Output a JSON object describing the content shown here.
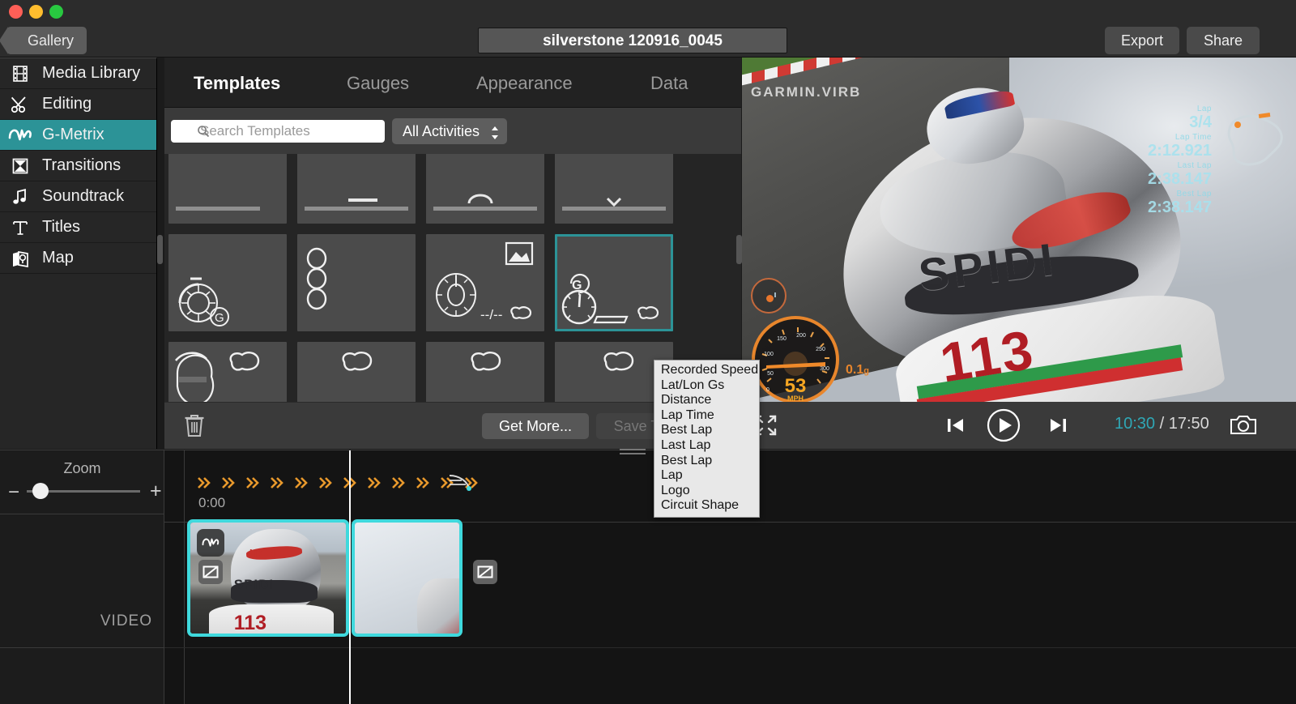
{
  "titlebar": {
    "back_label": "Gallery",
    "document_title": "silverstone 120916_0045",
    "export_label": "Export",
    "share_label": "Share"
  },
  "sidebar": {
    "items": [
      {
        "label": "Media Library",
        "icon": "film-strip-icon",
        "active": false
      },
      {
        "label": "Editing",
        "icon": "scissors-icon",
        "active": false
      },
      {
        "label": "G-Metrix",
        "icon": "pulse-icon",
        "active": true
      },
      {
        "label": "Transitions",
        "icon": "hourglass-icon",
        "active": false
      },
      {
        "label": "Soundtrack",
        "icon": "music-note-icon",
        "active": false
      },
      {
        "label": "Titles",
        "icon": "text-t-icon",
        "active": false
      },
      {
        "label": "Map",
        "icon": "map-icon",
        "active": false
      }
    ]
  },
  "panel": {
    "tabs": [
      {
        "label": "Templates",
        "active": true
      },
      {
        "label": "Gauges",
        "active": false
      },
      {
        "label": "Appearance",
        "active": false
      },
      {
        "label": "Data",
        "active": false
      }
    ],
    "search": {
      "placeholder": "Search Templates",
      "value": ""
    },
    "activity_filter": {
      "selected": "All Activities"
    },
    "footer": {
      "delete_label": "trash-icon",
      "get_more_label": "Get More...",
      "save_template_label": "Save Template"
    },
    "selected_template_index": 3
  },
  "context_menu": {
    "items": [
      "Recorded Speed",
      "Lat/Lon Gs",
      "Distance",
      "Lap Time",
      "Best Lap",
      "Last Lap",
      "Best Lap",
      "Lap",
      "Logo",
      "Circuit Shape"
    ]
  },
  "preview": {
    "watermark": "GARMIN.VIRB",
    "speed_value": "53",
    "speed_unit": "MPH",
    "gforce_value": "0.1",
    "gforce_unit": "g",
    "speedo_ticks": [
      "0",
      "50",
      "100",
      "150",
      "200",
      "250",
      "300"
    ],
    "lap_readouts": [
      {
        "label": "Lap",
        "value": "3/4"
      },
      {
        "label": "Lap Time",
        "value": "2:12.921"
      },
      {
        "label": "Last Lap",
        "value": "2:38.147"
      },
      {
        "label": "Best Lap",
        "value": "2:38.147"
      }
    ]
  },
  "transport": {
    "fullscreen_icon": "fullscreen-icon",
    "prev_frame_icon": "step-back-icon",
    "play_icon": "play-icon",
    "next_frame_icon": "step-forward-icon",
    "current_time": "10:30",
    "separator": " / ",
    "total_time": "17:50",
    "snapshot_icon": "camera-icon"
  },
  "timeline": {
    "zoom_label": "Zoom",
    "zoom_minus": "−",
    "zoom_plus": "+",
    "track_label": "VIDEO",
    "ruler_start": "0:00",
    "speed_marker_count": 12,
    "clips": [
      {
        "name": "clip-1",
        "has_gmetrix_badge": true
      },
      {
        "name": "clip-2",
        "has_gmetrix_badge": false
      }
    ]
  },
  "colors": {
    "accent_teal": "#2c9397",
    "clip_selection": "#3fd9dd",
    "speed_marker_orange": "#e8992c",
    "timecode_current": "#2fa7b5"
  }
}
